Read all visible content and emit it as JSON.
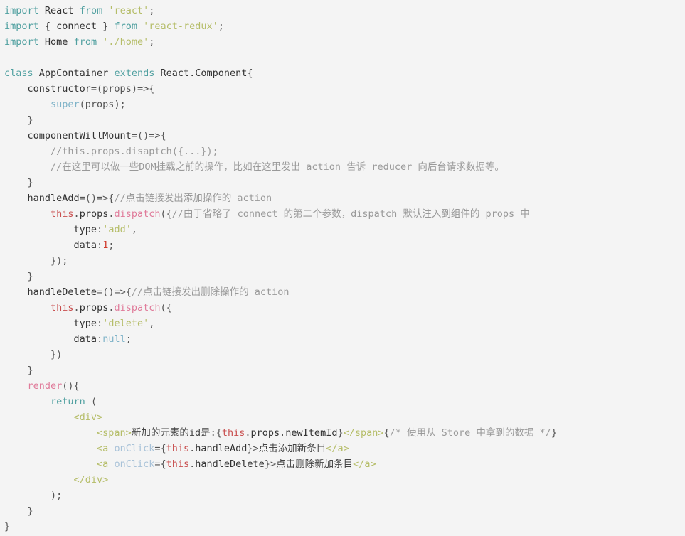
{
  "viewer": {
    "name": "code-snippet-viewer",
    "language": "jsx",
    "background_color": "#f4f4f4",
    "foreground_color": "#333333",
    "font_size_px": 13.5,
    "line_height_px": 22,
    "total_lines": 34
  },
  "theme": {
    "keyword": "#50a0a0",
    "string": "#b5bd68",
    "comment": "#999999",
    "function": "#e07b9a",
    "this_keyword": "#c94f4f",
    "builtin": "#7fb3c8",
    "number": "#d0392b",
    "jsx_tag": "#b5bd68",
    "jsx_attribute": "#a8c2d8",
    "punctuation": "#555555",
    "plain": "#333333"
  },
  "lines": [
    {
      "n": 1,
      "indent": 0,
      "tokens": [
        {
          "t": "keyword",
          "s": "import"
        },
        {
          "t": "plain",
          "s": " React "
        },
        {
          "t": "keyword",
          "s": "from"
        },
        {
          "t": "plain",
          "s": " "
        },
        {
          "t": "string",
          "s": "'react'"
        },
        {
          "t": "punct",
          "s": ";"
        }
      ]
    },
    {
      "n": 2,
      "indent": 0,
      "tokens": [
        {
          "t": "keyword",
          "s": "import"
        },
        {
          "t": "plain",
          "s": " { connect } "
        },
        {
          "t": "keyword",
          "s": "from"
        },
        {
          "t": "plain",
          "s": " "
        },
        {
          "t": "string",
          "s": "'react-redux'"
        },
        {
          "t": "punct",
          "s": ";"
        }
      ]
    },
    {
      "n": 3,
      "indent": 0,
      "tokens": [
        {
          "t": "keyword",
          "s": "import"
        },
        {
          "t": "plain",
          "s": " Home "
        },
        {
          "t": "keyword",
          "s": "from"
        },
        {
          "t": "plain",
          "s": " "
        },
        {
          "t": "string",
          "s": "'./home'"
        },
        {
          "t": "punct",
          "s": ";"
        }
      ]
    },
    {
      "n": 4,
      "indent": 0,
      "tokens": []
    },
    {
      "n": 5,
      "indent": 0,
      "tokens": [
        {
          "t": "keyword",
          "s": "class"
        },
        {
          "t": "plain",
          "s": " AppContainer "
        },
        {
          "t": "keyword",
          "s": "extends"
        },
        {
          "t": "plain",
          "s": " React.Component"
        },
        {
          "t": "punct",
          "s": "{"
        }
      ]
    },
    {
      "n": 6,
      "indent": 1,
      "tokens": [
        {
          "t": "plain",
          "s": "constructor"
        },
        {
          "t": "punct",
          "s": "=(props)=>{"
        }
      ]
    },
    {
      "n": 7,
      "indent": 2,
      "tokens": [
        {
          "t": "builtin",
          "s": "super"
        },
        {
          "t": "punct",
          "s": "(props);"
        }
      ]
    },
    {
      "n": 8,
      "indent": 1,
      "tokens": [
        {
          "t": "punct",
          "s": "}"
        }
      ]
    },
    {
      "n": 9,
      "indent": 1,
      "tokens": [
        {
          "t": "plain",
          "s": "componentWillMount"
        },
        {
          "t": "punct",
          "s": "=()=>{"
        }
      ]
    },
    {
      "n": 10,
      "indent": 2,
      "tokens": [
        {
          "t": "comment",
          "s": "//this.props.disaptch({...});"
        }
      ]
    },
    {
      "n": 11,
      "indent": 2,
      "tokens": [
        {
          "t": "comment",
          "s": "//在这里可以做一些DOM挂载之前的操作，比如在这里发出 action 告诉 reducer 向后台请求数据等。"
        }
      ]
    },
    {
      "n": 12,
      "indent": 1,
      "tokens": [
        {
          "t": "punct",
          "s": "}"
        }
      ]
    },
    {
      "n": 13,
      "indent": 1,
      "tokens": [
        {
          "t": "plain",
          "s": "handleAdd"
        },
        {
          "t": "punct",
          "s": "=()=>{"
        },
        {
          "t": "comment",
          "s": "//点击链接发出添加操作的 action"
        }
      ]
    },
    {
      "n": 14,
      "indent": 2,
      "tokens": [
        {
          "t": "this",
          "s": "this"
        },
        {
          "t": "punct",
          "s": "."
        },
        {
          "t": "plain",
          "s": "props"
        },
        {
          "t": "punct",
          "s": "."
        },
        {
          "t": "func",
          "s": "dispatch"
        },
        {
          "t": "punct",
          "s": "({"
        },
        {
          "t": "comment",
          "s": "//由于省略了 connect 的第二个参数，dispatch 默认注入到组件的 props 中"
        }
      ]
    },
    {
      "n": 15,
      "indent": 3,
      "tokens": [
        {
          "t": "plain",
          "s": "type"
        },
        {
          "t": "punct",
          "s": ":"
        },
        {
          "t": "string",
          "s": "'add'"
        },
        {
          "t": "punct",
          "s": ","
        }
      ]
    },
    {
      "n": 16,
      "indent": 3,
      "tokens": [
        {
          "t": "plain",
          "s": "data"
        },
        {
          "t": "punct",
          "s": ":"
        },
        {
          "t": "number",
          "s": "1"
        },
        {
          "t": "punct",
          "s": ";"
        }
      ]
    },
    {
      "n": 17,
      "indent": 2,
      "tokens": [
        {
          "t": "punct",
          "s": "});"
        }
      ]
    },
    {
      "n": 18,
      "indent": 1,
      "tokens": [
        {
          "t": "punct",
          "s": "}"
        }
      ]
    },
    {
      "n": 19,
      "indent": 1,
      "tokens": [
        {
          "t": "plain",
          "s": "handleDelete"
        },
        {
          "t": "punct",
          "s": "=()=>{"
        },
        {
          "t": "comment",
          "s": "//点击链接发出删除操作的 action"
        }
      ]
    },
    {
      "n": 20,
      "indent": 2,
      "tokens": [
        {
          "t": "this",
          "s": "this"
        },
        {
          "t": "punct",
          "s": "."
        },
        {
          "t": "plain",
          "s": "props"
        },
        {
          "t": "punct",
          "s": "."
        },
        {
          "t": "func",
          "s": "dispatch"
        },
        {
          "t": "punct",
          "s": "({"
        }
      ]
    },
    {
      "n": 21,
      "indent": 3,
      "tokens": [
        {
          "t": "plain",
          "s": "type"
        },
        {
          "t": "punct",
          "s": ":"
        },
        {
          "t": "string",
          "s": "'delete'"
        },
        {
          "t": "punct",
          "s": ","
        }
      ]
    },
    {
      "n": 22,
      "indent": 3,
      "tokens": [
        {
          "t": "plain",
          "s": "data"
        },
        {
          "t": "punct",
          "s": ":"
        },
        {
          "t": "builtin",
          "s": "null"
        },
        {
          "t": "punct",
          "s": ";"
        }
      ]
    },
    {
      "n": 23,
      "indent": 2,
      "tokens": [
        {
          "t": "punct",
          "s": "})"
        }
      ]
    },
    {
      "n": 24,
      "indent": 1,
      "tokens": [
        {
          "t": "punct",
          "s": "}"
        }
      ]
    },
    {
      "n": 25,
      "indent": 1,
      "tokens": [
        {
          "t": "func",
          "s": "render"
        },
        {
          "t": "punct",
          "s": "(){"
        }
      ]
    },
    {
      "n": 26,
      "indent": 2,
      "tokens": [
        {
          "t": "keyword",
          "s": "return"
        },
        {
          "t": "punct",
          "s": " ("
        }
      ]
    },
    {
      "n": 27,
      "indent": 3,
      "tokens": [
        {
          "t": "tag",
          "s": "<div>"
        }
      ]
    },
    {
      "n": 28,
      "indent": 4,
      "tokens": [
        {
          "t": "tag",
          "s": "<span>"
        },
        {
          "t": "cjk",
          "s": "新加的元素的id是:"
        },
        {
          "t": "punct",
          "s": "{"
        },
        {
          "t": "this",
          "s": "this"
        },
        {
          "t": "punct",
          "s": "."
        },
        {
          "t": "plain",
          "s": "props"
        },
        {
          "t": "punct",
          "s": "."
        },
        {
          "t": "plain",
          "s": "newItemId"
        },
        {
          "t": "punct",
          "s": "}"
        },
        {
          "t": "tag",
          "s": "</span>"
        },
        {
          "t": "punct",
          "s": "{"
        },
        {
          "t": "comment",
          "s": "/* 使用从 Store 中拿到的数据 */"
        },
        {
          "t": "punct",
          "s": "}"
        }
      ]
    },
    {
      "n": 29,
      "indent": 4,
      "tokens": [
        {
          "t": "tag",
          "s": "<a "
        },
        {
          "t": "attr",
          "s": "onClick"
        },
        {
          "t": "punct",
          "s": "={"
        },
        {
          "t": "this",
          "s": "this"
        },
        {
          "t": "punct",
          "s": "."
        },
        {
          "t": "plain",
          "s": "handleAdd"
        },
        {
          "t": "punct",
          "s": "}>"
        },
        {
          "t": "cjk",
          "s": "点击添加新条目"
        },
        {
          "t": "tag",
          "s": "</a>"
        }
      ]
    },
    {
      "n": 30,
      "indent": 4,
      "tokens": [
        {
          "t": "tag",
          "s": "<a "
        },
        {
          "t": "attr",
          "s": "onClick"
        },
        {
          "t": "punct",
          "s": "={"
        },
        {
          "t": "this",
          "s": "this"
        },
        {
          "t": "punct",
          "s": "."
        },
        {
          "t": "plain",
          "s": "handleDelete"
        },
        {
          "t": "punct",
          "s": "}>"
        },
        {
          "t": "cjk",
          "s": "点击删除新加条目"
        },
        {
          "t": "tag",
          "s": "</a>"
        }
      ]
    },
    {
      "n": 31,
      "indent": 3,
      "tokens": [
        {
          "t": "tag",
          "s": "</div>"
        }
      ]
    },
    {
      "n": 32,
      "indent": 2,
      "tokens": [
        {
          "t": "punct",
          "s": ");"
        }
      ]
    },
    {
      "n": 33,
      "indent": 1,
      "tokens": [
        {
          "t": "punct",
          "s": "}"
        }
      ]
    },
    {
      "n": 34,
      "indent": 0,
      "tokens": [
        {
          "t": "punct",
          "s": "}"
        }
      ]
    }
  ]
}
